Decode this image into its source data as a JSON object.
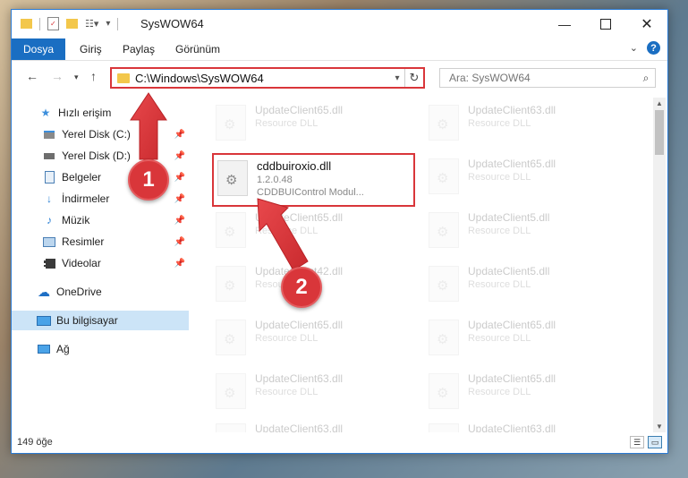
{
  "window": {
    "title": "SysWOW64"
  },
  "ribbon": {
    "file_tab": "Dosya",
    "tabs": [
      "Giriş",
      "Paylaş",
      "Görünüm"
    ]
  },
  "address": {
    "path": "C:\\Windows\\SysWOW64"
  },
  "search": {
    "placeholder": "Ara: SysWOW64"
  },
  "sidebar": {
    "items": [
      {
        "label": "Hızlı erişim",
        "icon": "star-icon"
      },
      {
        "label": "Yerel Disk (C:)",
        "icon": "drive-icon",
        "pinned": true
      },
      {
        "label": "Yerel Disk (D:)",
        "icon": "drive-icon",
        "pinned": true
      },
      {
        "label": "Belgeler",
        "icon": "documents-icon",
        "pinned": true
      },
      {
        "label": "İndirmeler",
        "icon": "downloads-icon",
        "pinned": true
      },
      {
        "label": "Müzik",
        "icon": "music-icon",
        "pinned": true
      },
      {
        "label": "Resimler",
        "icon": "pictures-icon",
        "pinned": true
      },
      {
        "label": "Videolar",
        "icon": "videos-icon",
        "pinned": true
      },
      {
        "label": "OneDrive",
        "icon": "cloud-icon"
      },
      {
        "label": "Bu bilgisayar",
        "icon": "computer-icon",
        "selected": true
      },
      {
        "label": "Ağ",
        "icon": "network-icon"
      }
    ]
  },
  "files": {
    "highlighted": {
      "name": "cddbuiroxio.dll",
      "version": "1.2.0.48",
      "description": "CDDBUIControl Modul..."
    },
    "left": [
      {
        "name": "UpdateClient65.dll",
        "type": "Resource DLL"
      },
      null,
      {
        "name": "UpdateClient65.dll",
        "type": "Resource DLL"
      },
      {
        "name": "UpdateClient42.dll",
        "type": "Resource DLL"
      },
      {
        "name": "UpdateClient65.dll",
        "type": "Resource DLL"
      },
      {
        "name": "UpdateClient63.dll",
        "type": "Resource DLL"
      },
      {
        "name": "UpdateClient63.dll",
        "type": "Resource DLL"
      }
    ],
    "right": [
      {
        "name": "UpdateClient63.dll",
        "type": "Resource DLL"
      },
      {
        "name": "UpdateClient65.dll",
        "type": "Resource DLL"
      },
      {
        "name": "UpdateClient5.dll",
        "type": "Resource DLL"
      },
      {
        "name": "UpdateClient5.dll",
        "type": "Resource DLL"
      },
      {
        "name": "UpdateClient65.dll",
        "type": "Resource DLL"
      },
      {
        "name": "UpdateClient65.dll",
        "type": "Resource DLL"
      },
      {
        "name": "UpdateClient63.dll",
        "type": "Resource DLL"
      }
    ]
  },
  "status": {
    "count": "149 öğe"
  },
  "annotations": {
    "marker1": "1",
    "marker2": "2",
    "color": "#d9363a"
  }
}
